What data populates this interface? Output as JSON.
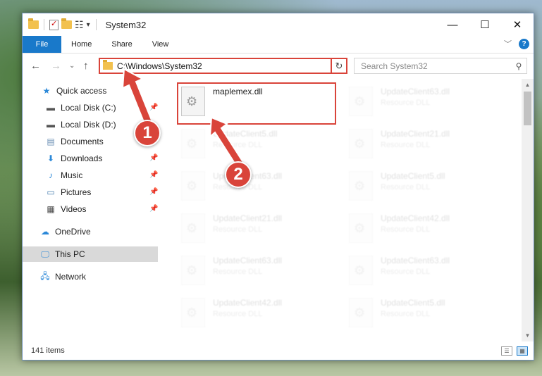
{
  "window": {
    "title": "System32",
    "controls": {
      "minimize": "—",
      "maximize": "☐",
      "close": "✕"
    }
  },
  "ribbon": {
    "file_tab": "File",
    "tabs": [
      "Home",
      "Share",
      "View"
    ]
  },
  "address": {
    "path": "C:\\Windows\\System32"
  },
  "search": {
    "placeholder": "Search System32"
  },
  "sidebar": {
    "items": [
      {
        "label": "Quick access",
        "icon": "star-icon"
      },
      {
        "label": "Local Disk (C:)",
        "icon": "drive-icon"
      },
      {
        "label": "Local Disk (D:)",
        "icon": "drive-icon"
      },
      {
        "label": "Documents",
        "icon": "documents-icon"
      },
      {
        "label": "Downloads",
        "icon": "download-icon"
      },
      {
        "label": "Music",
        "icon": "music-icon"
      },
      {
        "label": "Pictures",
        "icon": "pictures-icon"
      },
      {
        "label": "Videos",
        "icon": "videos-icon"
      },
      {
        "label": "OneDrive",
        "icon": "cloud-icon"
      },
      {
        "label": "This PC",
        "icon": "pc-icon"
      },
      {
        "label": "Network",
        "icon": "network-icon"
      }
    ]
  },
  "files": {
    "highlighted": {
      "name": "maplemex.dll",
      "type": ""
    },
    "ghost": [
      {
        "name": "UpdateClient63.dll",
        "type": "Resource DLL"
      },
      {
        "name": "UpdateClient5.dll",
        "type": "Resource DLL"
      },
      {
        "name": "UpdateClient21.dll",
        "type": "Resource DLL"
      },
      {
        "name": "UpdateClient63.dll",
        "type": "Resource DLL"
      },
      {
        "name": "UpdateClient5.dll",
        "type": "Resource DLL"
      },
      {
        "name": "UpdateClient21.dll",
        "type": "Resource DLL"
      },
      {
        "name": "UpdateClient42.dll",
        "type": "Resource DLL"
      },
      {
        "name": "UpdateClient63.dll",
        "type": "Resource DLL"
      },
      {
        "name": "UpdateClient63.dll",
        "type": "Resource DLL"
      },
      {
        "name": "UpdateClient42.dll",
        "type": "Resource DLL"
      },
      {
        "name": "UpdateClient5.dll",
        "type": "Resource DLL"
      }
    ]
  },
  "status": {
    "item_count": "141 items"
  },
  "annotations": {
    "step1": "1",
    "step2": "2",
    "color": "#d9443a"
  }
}
